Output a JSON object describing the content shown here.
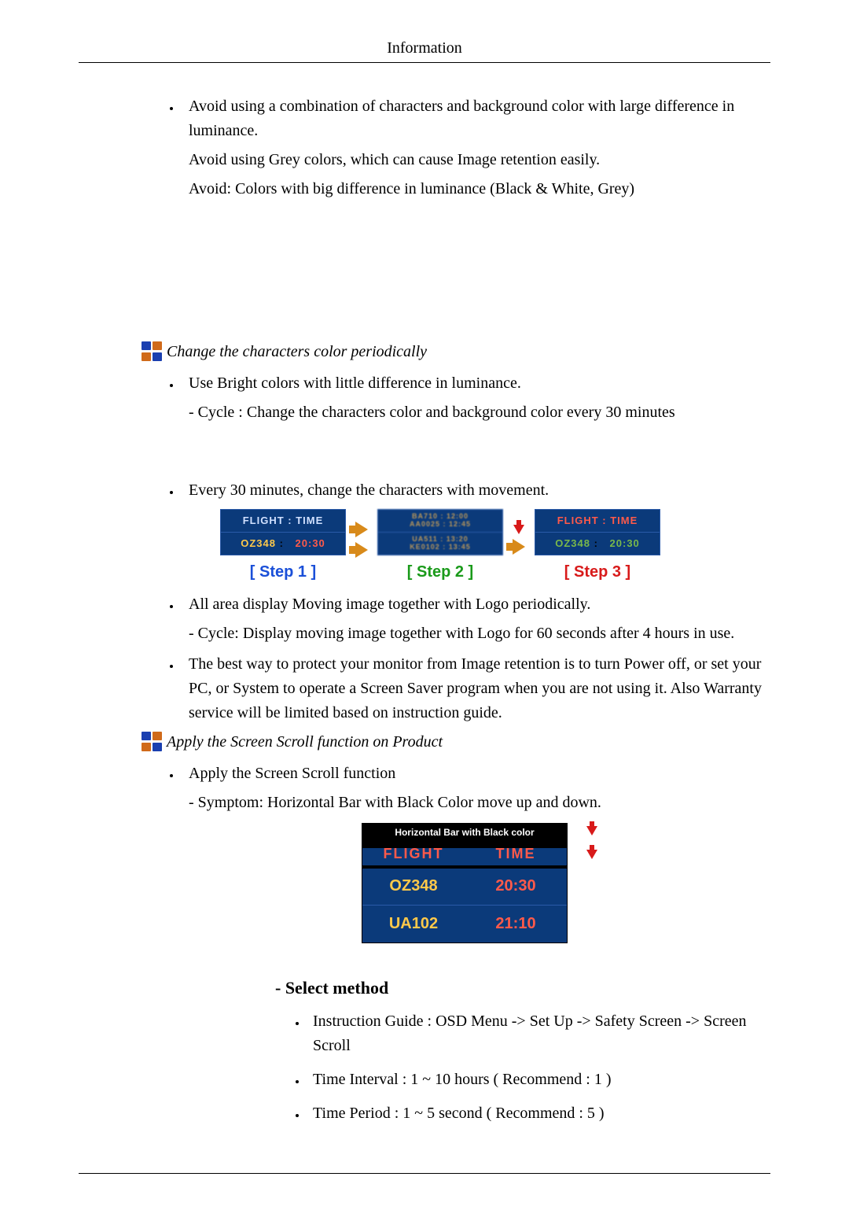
{
  "header": {
    "title": "Information"
  },
  "intro": {
    "b1_l1": "Avoid using a combination of characters and background color with large difference in luminance.",
    "b1_l2": "Avoid using Grey colors, which can cause Image retention easily.",
    "b1_l3": "Avoid: Colors with big difference in luminance (Black & White, Grey)"
  },
  "sect1": {
    "title": "Change the characters color periodically",
    "b1": "Use Bright colors with little difference in luminance.",
    "b1_sub": "- Cycle : Change the characters color and background color every 30 minutes",
    "b2": "Every 30 minutes, change the characters with movement.",
    "b3": "All area display Moving image together with Logo periodically.",
    "b3_sub": "- Cycle: Display moving image together with Logo for 60 seconds after 4 hours in use.",
    "b4": "The best way to protect your monitor from Image retention is to turn Power off, or set your PC, or System to operate a Screen Saver program when you are not using it. Also Warranty service will be limited based on instruction guide."
  },
  "steps": {
    "top_label": "FLIGHT  :  TIME",
    "flight": "OZ348",
    "time": "20:30",
    "s2_t1": "BA710 : 12:00",
    "s2_t2": "AA0025 : 12:45",
    "s2_b1": "UA511 : 13:20",
    "s2_b2": "KE0102 : 13:45",
    "step1": "[ Step 1 ]",
    "step2": "[ Step 2 ]",
    "step3": "[ Step 3 ]"
  },
  "sect2": {
    "title": "Apply the Screen Scroll function on Product",
    "b1": "Apply the Screen Scroll function",
    "b1_sub": "- Symptom: Horizontal Bar with Black Color move up and down."
  },
  "hbar": {
    "title": "Horizontal Bar with Black color",
    "h1": "FLIGHT",
    "h2": "TIME",
    "r1c1": "OZ348",
    "r1c2": "20:30",
    "r2c1": "UA102",
    "r2c2": "21:10"
  },
  "select": {
    "heading": "- Select method",
    "i1": "Instruction Guide : OSD Menu -> Set Up -> Safety Screen -> Screen Scroll",
    "i2": "Time Interval : 1 ~ 10 hours ( Recommend : 1 )",
    "i3": "Time Period : 1 ~ 5 second ( Recommend : 5 )"
  }
}
